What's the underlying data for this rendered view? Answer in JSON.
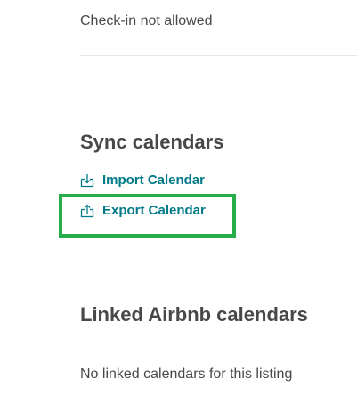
{
  "checkin": {
    "status_text": "Check-in not allowed"
  },
  "sync": {
    "title": "Sync calendars",
    "import_label": "Import Calendar",
    "import_icon": "import-icon",
    "export_label": "Export Calendar",
    "export_icon": "export-icon"
  },
  "linked": {
    "title": "Linked Airbnb calendars",
    "empty_text": "No linked calendars for this listing"
  },
  "colors": {
    "link": "#007a87",
    "text": "#484848",
    "highlight": "#27ae4a"
  }
}
